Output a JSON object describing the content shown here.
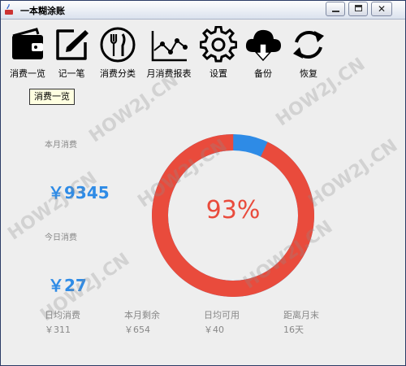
{
  "window": {
    "title": "一本糊涂账"
  },
  "toolbar": {
    "items": [
      {
        "label": "消费一览",
        "icon": "wallet-icon"
      },
      {
        "label": "记一笔",
        "icon": "edit-icon"
      },
      {
        "label": "消费分类",
        "icon": "fork-knife-icon"
      },
      {
        "label": "月消费报表",
        "icon": "line-chart-icon"
      },
      {
        "label": "设置",
        "icon": "gear-icon"
      },
      {
        "label": "备份",
        "icon": "cloud-download-icon"
      },
      {
        "label": "恢复",
        "icon": "refresh-icon"
      }
    ]
  },
  "tooltip": "消费一览",
  "summary": {
    "month_label": "本月消费",
    "month_value": "￥9345",
    "today_label": "今日消费",
    "today_value": "￥27",
    "stats": [
      {
        "label": "日均消费",
        "value": "￥311"
      },
      {
        "label": "本月剩余",
        "value": "￥654"
      },
      {
        "label": "日均可用",
        "value": "￥40"
      },
      {
        "label": "距离月末",
        "value": "16天"
      }
    ],
    "usage_percent_text": "93%",
    "usage_fraction": 0.93
  },
  "watermark": "HOW2J.CN",
  "colors": {
    "accent": "#2e8be6",
    "ring": "#e94b3c",
    "ring_remaining": "#2e8be6"
  }
}
